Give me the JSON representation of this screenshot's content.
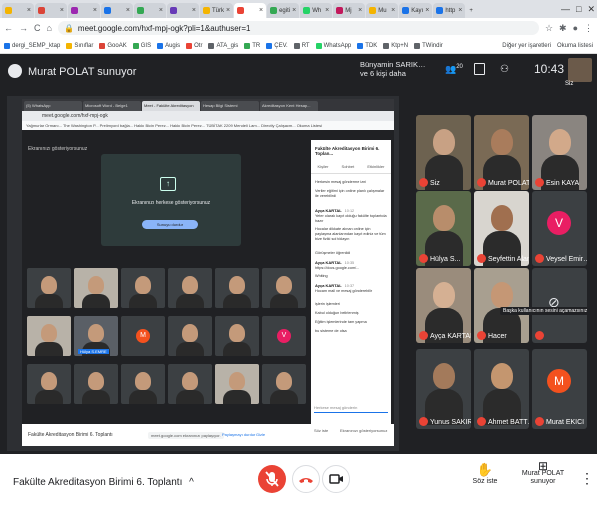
{
  "browser": {
    "tabs": [
      {
        "label": "",
        "color": "#f4b400"
      },
      {
        "label": "",
        "color": "#db4437"
      },
      {
        "label": "",
        "color": "#9c27b0"
      },
      {
        "label": "",
        "color": "#1a73e8"
      },
      {
        "label": "",
        "color": "#34a853"
      },
      {
        "label": "",
        "color": "#673ab7"
      },
      {
        "label": "Türk",
        "color": "#f4b400"
      },
      {
        "label": "",
        "color": "#ea4335",
        "active": true
      },
      {
        "label": "egiti",
        "color": "#34a853"
      },
      {
        "label": "Wh",
        "color": "#25d366"
      },
      {
        "label": "Mj",
        "color": "#c2185b"
      },
      {
        "label": "Mu",
        "color": "#f4b400"
      },
      {
        "label": "Kayı",
        "color": "#1a73e8"
      },
      {
        "label": "http",
        "color": "#1a73e8"
      }
    ],
    "new_tab": "+",
    "url": "meet.google.com/hxf-mpj-ogk?pli=1&authuser=1",
    "bookmarks": [
      "dergi_SEMP_ktap",
      "Sınıflar",
      "GooAK",
      "GIS",
      "Augis",
      "Otr",
      "ATA_gis",
      "TR",
      "ÇEV.",
      "RT",
      "WhatsApp",
      "TDK",
      "Ktp+N",
      "TWindir"
    ],
    "bookmarks_right": [
      "Diğer yer işaretleri",
      "Okuma listesi"
    ],
    "bookmark_colors": [
      "#1a73e8",
      "#f4b400",
      "#db4437",
      "#34a853",
      "#1a73e8",
      "#ea4335",
      "#5f6368",
      "#34a853",
      "#1a73e8",
      "#5f6368",
      "#25d366",
      "#1a73e8",
      "#5f6368",
      "#5f6368"
    ]
  },
  "meet_top": {
    "presenter": "Murat POLAT sunuyor",
    "people_line1": "Bünyamin SARIK…",
    "people_line2": "ve 6 kişi daha",
    "participant_count": "20",
    "clock": "10:43",
    "self_label": "Siz"
  },
  "shared_screen": {
    "inner_tabs": [
      "(5) WhatsApp",
      "Microsoft Word - Belge1",
      "Meet - Fakülte Akreditasyon",
      "Hesap Bilgi Sistemi",
      "Akreditasyon Kent Hesap..."
    ],
    "inner_url": "meet.google.com/hxf-mpj-ogk",
    "inner_bookmarks": "Yağmurlar Ormanı...  The Washington P...  Prelimyord bağla...  Hakkı Bicin Perez...  Hakkı Bicin Perez...  TÜBİTAK 2209  Mendeli Lam...  Directly Çalışacm...  Okuma Listesi",
    "showing_label": "Ekranınızı gösteriyorsunuz",
    "present_text": "Ekranınızı herkese gösteriyorsunuz",
    "present_button": "Sunuyu durdur",
    "meeting_name": "Fakülte Akreditasyon Birimi 6. Toplantı",
    "share_note": "meet.google.com ekranınızı paylaşıyor.",
    "share_stop": "Paylaşmayı durdur",
    "share_hide": "Gizle",
    "raise": "Söz iste",
    "present_now": "Ekranınızı gösteriyorsunuz",
    "tile_name": "Hülya S.EMRE",
    "tile_avatars": [
      {
        "letter": "S",
        "color": "#e91e63"
      },
      {
        "letter": "M",
        "color": "#f4511e"
      },
      {
        "letter": "V",
        "color": "#e91e63"
      }
    ]
  },
  "chat": {
    "title": "Fakülte Akreditasyon Birimi 6. Toplan...",
    "tabs": [
      "Kişiler",
      "Sohbet",
      "Etkinlikler"
    ],
    "messages": [
      {
        "author": "",
        "text": "Herkesin mesaj gönderme izni"
      },
      {
        "author": "",
        "text": "Veriler eğitimi için online planlı çalışmalar ile verebilirdi"
      },
      {
        "author": "Ayça KARTAL",
        "time": "10:12",
        "text": "Yeter olarak kayıt olduğu fakülte toplantıda hazır"
      },
      {
        "author": "",
        "text": "Hocalar dikkate alınan online için paylaşma alanlarından kayıt ediniz ve tüm bize fiziki sol tıklayın"
      },
      {
        "author": "",
        "text": "Görüşmeler öğrenildi"
      },
      {
        "author": "Ayça KARTAL",
        "time": "10:35",
        "text": "https://docs.google.com/..."
      },
      {
        "author": "",
        "text": "Whiting"
      },
      {
        "author": "Ayça KARTAL",
        "time": "10:37",
        "text": "Hocam mail ve mesaj gönderebilir"
      },
      {
        "author": "",
        "text": "işlerin işlemleri"
      },
      {
        "author": "",
        "text": "Kabul olduğun belirlenmiş"
      },
      {
        "author": "",
        "text": "Eğitim işlemlerinde tam yapma"
      },
      {
        "author": "",
        "text": "bu sisteme de olsa"
      }
    ],
    "input_placeholder": "Herkese mesaj gönderin"
  },
  "participants": [
    {
      "name": "Siz",
      "muted": true
    },
    {
      "name": "Murat POLAT",
      "muted": true
    },
    {
      "name": "Esin KAYA",
      "muted": true
    },
    {
      "name": "Hülya S...",
      "muted": true
    },
    {
      "name": "Seyfettin Alan",
      "muted": true
    },
    {
      "name": "Veysel Emir…",
      "muted": true,
      "avatar": "V",
      "avatar_color": "#e91e63"
    },
    {
      "name": "Ayça KARTAL",
      "muted": true
    },
    {
      "name": "Hacer",
      "muted": true
    },
    {
      "name": "",
      "muted": true
    },
    {
      "name": "Yunus SAKIR…",
      "muted": true
    },
    {
      "name": "Ahmet BATT…",
      "muted": true
    },
    {
      "name": "Murat EKICI",
      "muted": true,
      "avatar": "M",
      "avatar_color": "#f4511e"
    }
  ],
  "mute_tip": "Başka kullanıcının sesini açamazsınız",
  "bottom": {
    "meeting_title": "Fakülte Akreditasyon Birimi 6. Toplantı",
    "chevron": "^",
    "raise_label": "Söz iste",
    "present_label": "Murat POLAT sunuyor",
    "more": "⋮"
  }
}
